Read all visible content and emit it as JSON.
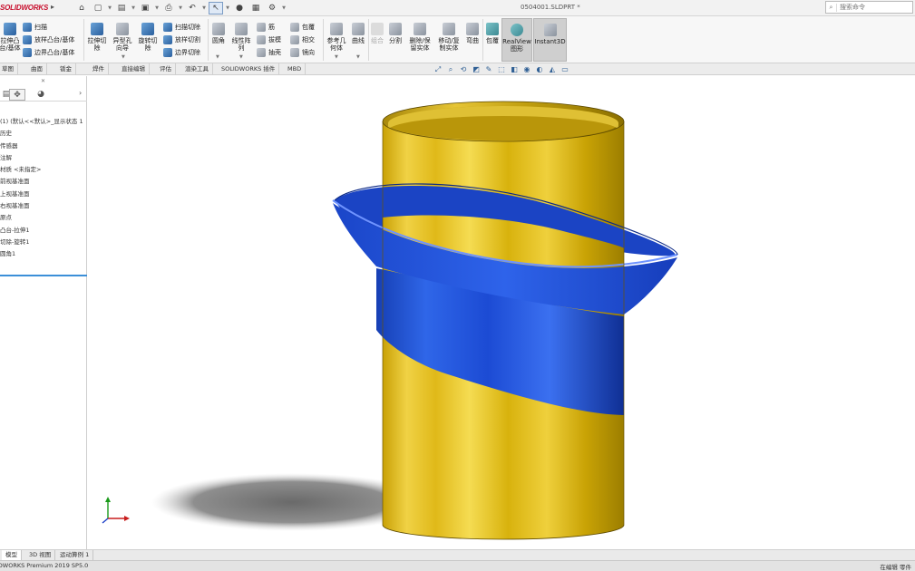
{
  "app": {
    "logo_text": "SOLIDWORKS",
    "document_title": "0504001.SLDPRT *",
    "search_placeholder": "搜索命令"
  },
  "ribbon": {
    "extrude_boss": "拉伸凸\n台/基体",
    "revolve_boss": "旋转凸\n台/基体",
    "sweep_boss": "扫描",
    "loft_boss": "放样凸台/基体",
    "boundary_boss": "边界凸台/基体",
    "extrude_cut": "拉伸切\n除",
    "hole_wizard": "异型孔\n向导",
    "revolve_cut": "旋转切\n除",
    "sweep_cut": "扫描切除",
    "loft_cut": "放样切割",
    "boundary_cut": "边界切除",
    "fillet": "圆角",
    "linear_pattern": "线性阵\n列",
    "rib": "筋",
    "draft": "拔模",
    "shell": "抽壳",
    "wrap": "包覆",
    "intersect": "相交",
    "mirror": "镜向",
    "reference_geometry": "参考几\n何体",
    "curves": "曲线",
    "combine": "组合",
    "split": "分割",
    "delete_keep_body": "删除/保\n留实体",
    "move_copy_body": "移动/复\n制实体",
    "bend": "弯曲",
    "wrap2": "包覆",
    "realview": "RealView\n图形",
    "instant3d": "Instant3D"
  },
  "command_tabs": [
    "特征",
    "草图",
    "曲面",
    "钣金",
    "焊件",
    "直接编辑",
    "评估",
    "渲染工具",
    "SOLIDWORKS 插件",
    "MBD"
  ],
  "feature_tree": {
    "items": [
      "(1)  (默认<<默认>_显示状态 1",
      "历史",
      "传感器",
      "注解",
      "材质 <未指定>",
      "前视基准面",
      "上视基准面",
      "右视基准面",
      "原点",
      "凸台-拉伸1",
      "切除-旋转1",
      "圆角1"
    ]
  },
  "bottom_tabs": [
    "模型",
    "3D 视图",
    "运动算例 1"
  ],
  "status": {
    "left": "SOLIDWORKS Premium 2019 SP5.0",
    "right": "在编辑 零件"
  },
  "colors": {
    "tube": "#e8c21c",
    "flange": "#1f4fd6",
    "logo": "#c8102e"
  }
}
